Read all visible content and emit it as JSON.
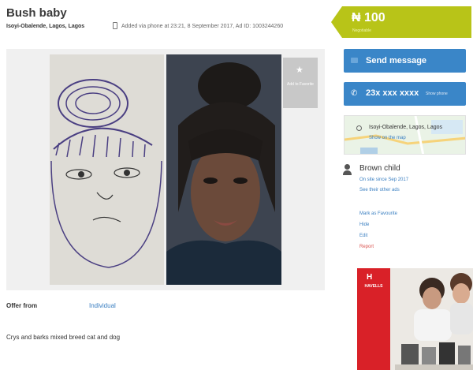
{
  "ad": {
    "title": "Bush baby",
    "location": "Isoyi-Obalende, Lagos, Lagos",
    "meta": "Added via phone at 23:21, 8 September 2017, Ad ID: 1003244260"
  },
  "price": {
    "value": "₦ 100",
    "note": "Negotiable"
  },
  "gallery": {
    "favorite_label": "Add to Favorite",
    "favorite_icon": "star-icon"
  },
  "details": {
    "offer_label": "Offer from",
    "offer_value": "Individual",
    "description": "Crys and barks mixed breed cat and dog"
  },
  "actions_panel": {
    "send_message": "Send message",
    "phone_masked": "23x xxx xxxx",
    "show_phone": "Show phone"
  },
  "map": {
    "location": "Isoyi-Obalende, Lagos, Lagos",
    "show_map": "Show on the map"
  },
  "seller": {
    "name": "Brown child",
    "since": "On site since Sep 2017",
    "other_ads": "See their other ads"
  },
  "ad_actions": {
    "favorite": "Mark as Favourite",
    "hide": "Hide",
    "edit": "Edit",
    "report": "Report"
  },
  "banner": {
    "brand": "HAVELLS"
  },
  "colors": {
    "price_tag": "#b8c418",
    "primary_button": "#3a86c8",
    "link": "#3a7fc1",
    "report": "#d9534f",
    "banner_red": "#d92128"
  }
}
